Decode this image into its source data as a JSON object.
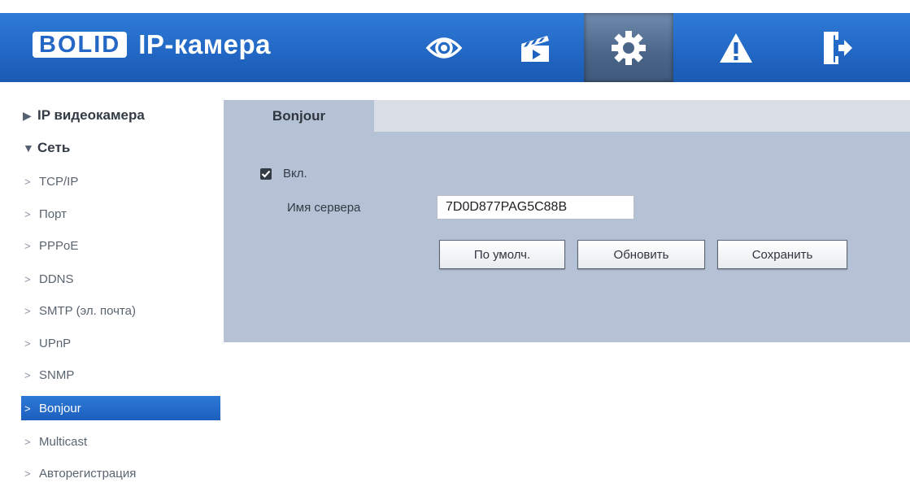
{
  "header": {
    "logo_brand": "BOLID",
    "logo_title": "IP-камера",
    "nav_icons": [
      "eye-icon",
      "clapperboard-icon",
      "gear-icon",
      "warning-icon",
      "logout-icon"
    ],
    "active_icon": "gear-icon",
    "colors": {
      "bar": "#1f63bf",
      "active": "#4a6588"
    }
  },
  "sidebar": {
    "groups": [
      {
        "label": "IP видеокамера",
        "expanded": false
      },
      {
        "label": "Сеть",
        "expanded": true
      }
    ],
    "items": [
      {
        "label": "TCP/IP"
      },
      {
        "label": "Порт"
      },
      {
        "label": "PPPoE"
      },
      {
        "label": "DDNS"
      },
      {
        "label": "SMTP (эл. почта)"
      },
      {
        "label": "UPnP"
      },
      {
        "label": "SNMP"
      },
      {
        "label": "Bonjour",
        "active": true
      },
      {
        "label": "Multicast"
      },
      {
        "label": "Авторегистрация"
      }
    ]
  },
  "main": {
    "tab": "Bonjour",
    "enable": {
      "label": "Вкл.",
      "checked": true
    },
    "server_name": {
      "label": "Имя сервера",
      "value": "7D0D877PAG5C88B"
    },
    "buttons": {
      "default": "По умолч.",
      "refresh": "Обновить",
      "save": "Сохранить"
    }
  }
}
